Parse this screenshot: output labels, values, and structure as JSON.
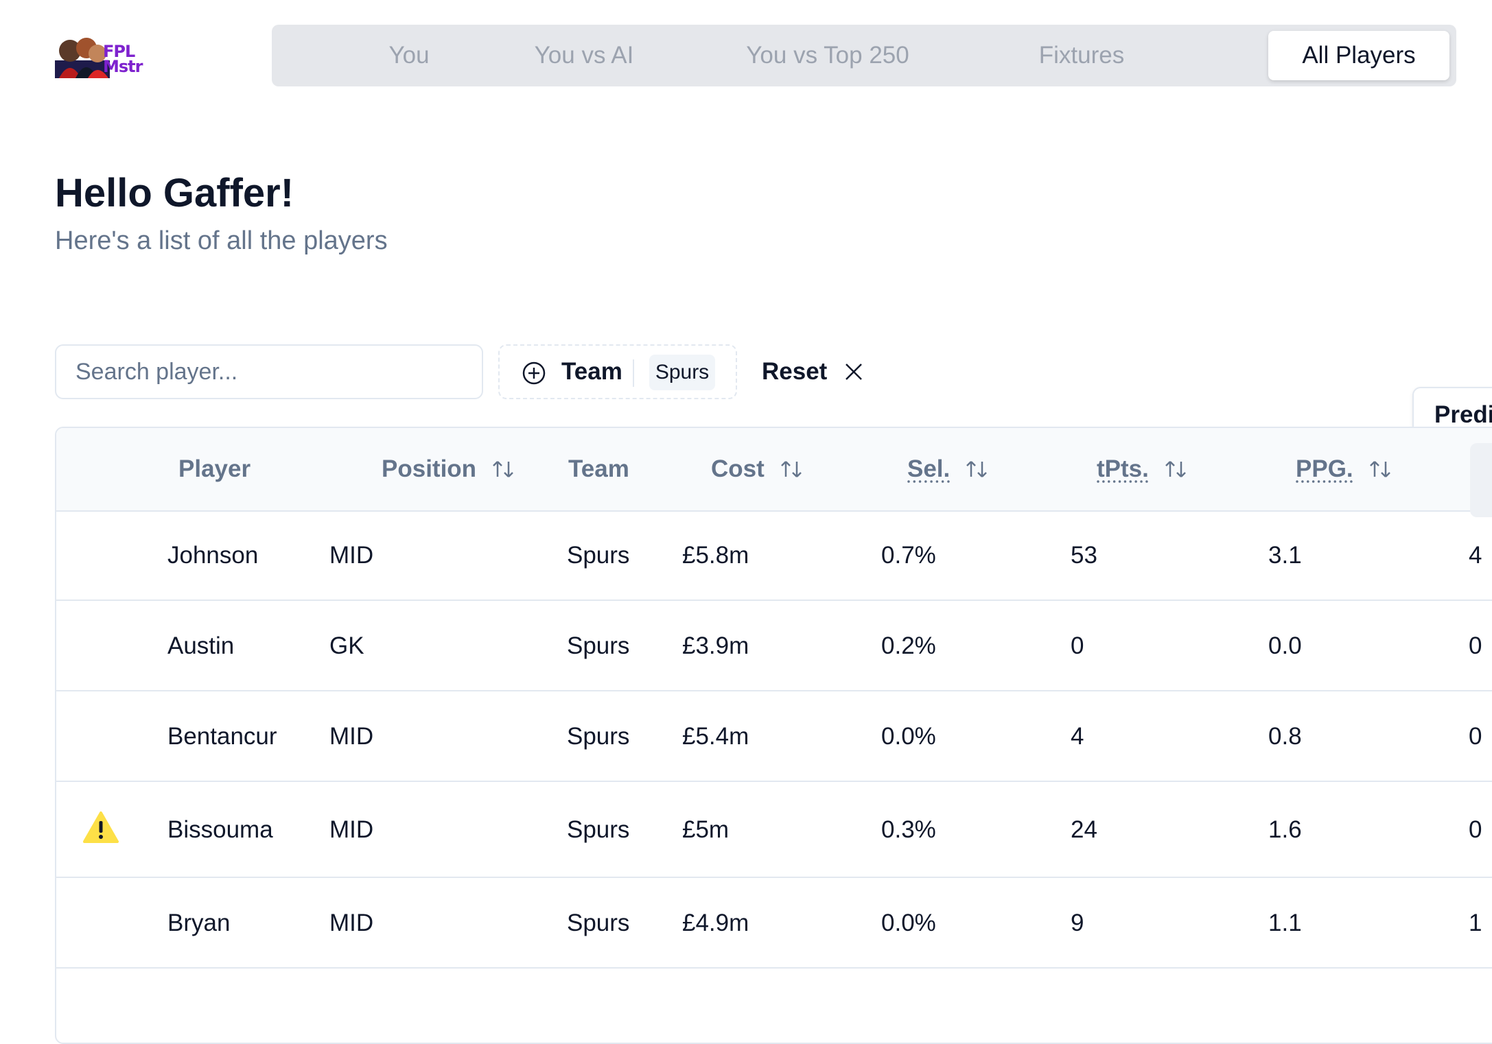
{
  "app": {
    "logo_text": "FPL\nMstr"
  },
  "nav": {
    "tabs": [
      {
        "label": "You",
        "active": false
      },
      {
        "label": "You vs AI",
        "active": false
      },
      {
        "label": "You vs Top 250",
        "active": false
      },
      {
        "label": "Fixtures",
        "active": false
      },
      {
        "label": "All Players",
        "active": true
      }
    ]
  },
  "header": {
    "title": "Hello Gaffer!",
    "subtitle": "Here's a list of all the players"
  },
  "toolbar": {
    "search_placeholder": "Search player...",
    "team_filter_label": "Team",
    "team_filter_value": "Spurs",
    "reset_label": "Reset",
    "predict_label": "Predi"
  },
  "table": {
    "columns": [
      {
        "label": "Player",
        "sortable": false,
        "abbr": false
      },
      {
        "label": "Position",
        "sortable": true,
        "abbr": false
      },
      {
        "label": "Team",
        "sortable": false,
        "abbr": false
      },
      {
        "label": "Cost",
        "sortable": true,
        "abbr": false
      },
      {
        "label": "Sel.",
        "sortable": true,
        "abbr": true
      },
      {
        "label": "tPts.",
        "sortable": true,
        "abbr": true
      },
      {
        "label": "PPG.",
        "sortable": true,
        "abbr": true
      }
    ],
    "rows": [
      {
        "warning": false,
        "player": "Johnson",
        "position": "MID",
        "team": "Spurs",
        "cost": "£5.8m",
        "sel": "0.7%",
        "tpts": "53",
        "ppg": "3.1",
        "next": "4"
      },
      {
        "warning": false,
        "player": "Austin",
        "position": "GK",
        "team": "Spurs",
        "cost": "£3.9m",
        "sel": "0.2%",
        "tpts": "0",
        "ppg": "0.0",
        "next": "0"
      },
      {
        "warning": false,
        "player": "Bentancur",
        "position": "MID",
        "team": "Spurs",
        "cost": "£5.4m",
        "sel": "0.0%",
        "tpts": "4",
        "ppg": "0.8",
        "next": "0"
      },
      {
        "warning": true,
        "player": "Bissouma",
        "position": "MID",
        "team": "Spurs",
        "cost": "£5m",
        "sel": "0.3%",
        "tpts": "24",
        "ppg": "1.6",
        "next": "0"
      },
      {
        "warning": false,
        "player": "Bryan",
        "position": "MID",
        "team": "Spurs",
        "cost": "£4.9m",
        "sel": "0.0%",
        "tpts": "9",
        "ppg": "1.1",
        "next": "1"
      }
    ]
  },
  "colors": {
    "accent_purple": "#7e22ce",
    "warning_yellow": "#fde047",
    "muted_text": "#64748b"
  }
}
